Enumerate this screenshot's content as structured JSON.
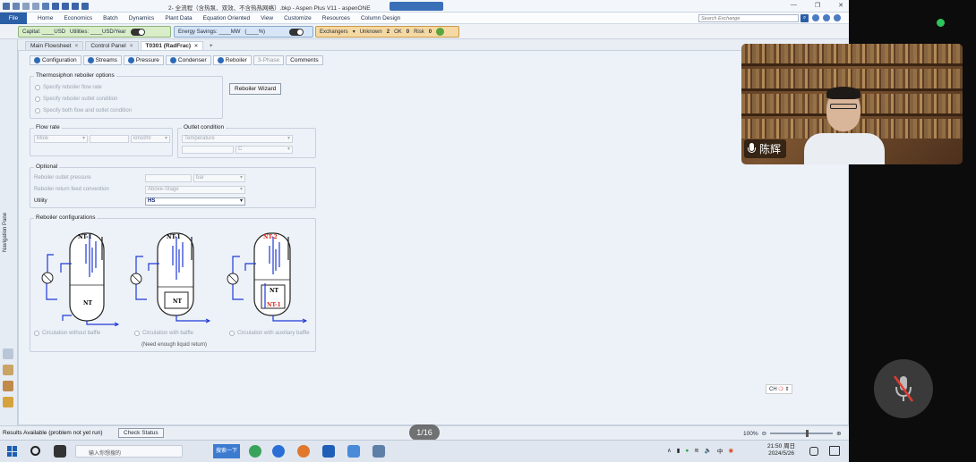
{
  "window": {
    "title": "2- 全流程（含热泵、双效、不含热热网络）.bkp - Aspen Plus V11 - aspenONE",
    "badge": "",
    "controls": [
      "—",
      "❐",
      "✕"
    ]
  },
  "menu": {
    "file": "File",
    "items": [
      "Home",
      "Economics",
      "Batch",
      "Dynamics",
      "Plant Data",
      "Equation Oriented",
      "View",
      "Customize",
      "Resources",
      "Column Design"
    ],
    "search_placeholder": "Search Exchange"
  },
  "econbar": {
    "capital": "Capital: ____USD",
    "utilities": "Utilities: ____USD/Year",
    "energy": "Energy Savings: ____MW",
    "energy_pct": "(____%)",
    "exchangers": "Exchangers",
    "unknown_label": "Unknown",
    "unknown_val": "2",
    "ok_label": "OK",
    "ok_val": "0",
    "risk_label": "Risk",
    "risk_val": "0"
  },
  "navpane": {
    "label": "Navigation Pane"
  },
  "doctabs": [
    {
      "label": "Main Flowsheet",
      "active": false
    },
    {
      "label": "Control Panel",
      "active": false
    },
    {
      "label": "T0301 (RadFrac)",
      "active": true
    }
  ],
  "doctab_add": "+",
  "formtabs": [
    {
      "label": "Configuration",
      "state": "done"
    },
    {
      "label": "Streams",
      "state": "done"
    },
    {
      "label": "Pressure",
      "state": "done"
    },
    {
      "label": "Condenser",
      "state": "done"
    },
    {
      "label": "Reboiler",
      "state": "active"
    },
    {
      "label": "3-Phase",
      "state": "disabled"
    },
    {
      "label": "Comments",
      "state": "plain"
    }
  ],
  "thermosiphon": {
    "title": "Thermosiphon reboiler options",
    "options": [
      "Specify reboiler flow rate",
      "Specify reboiler outlet condition",
      "Specify both flow and outlet condition"
    ]
  },
  "reboiler_wizard": "Reboiler Wizard",
  "flowrate": {
    "title": "Flow rate",
    "basis": "Mole",
    "unit": "kmol/hr"
  },
  "outlet": {
    "title": "Outlet condition",
    "type": "Temperature",
    "unit": "C"
  },
  "optional": {
    "title": "Optional",
    "pressure_label": "Reboiler outlet pressure",
    "pressure_unit": "bar",
    "return_label": "Reboiler return feed convention",
    "return_value": "Above-Stage",
    "utility_label": "Utility",
    "utility_value": "HS"
  },
  "configs": {
    "title": "Reboiler configurations",
    "options": [
      "Circulation without baffle",
      "Circulation with baffle",
      "Circulation with auxiliary baffle"
    ],
    "note": "(Need enough liquid return)",
    "diagram_labels": {
      "d1_top": "NT-1",
      "d1_bottom": "NT",
      "d2_top": "NT-1",
      "d2_bottom": "NT",
      "d3_top": "NT-2",
      "d3_bottom": "NT",
      "d3_inner": "NT-1"
    }
  },
  "status": {
    "text": "Results Available (problem not yet run)",
    "check": "Check Status",
    "zoom": "100%"
  },
  "page_indicator": "1/16",
  "ime": "CH",
  "taskbar": {
    "search": "输入你想搜的",
    "button": "搜索一下",
    "time": "21:50 周日",
    "date": "2024/5/26"
  },
  "video": {
    "speaker_name": "陈辉"
  },
  "colors": {
    "file_blue": "#2b5fa6",
    "capital_green": "#d9edc9",
    "energy_blue": "#d6e6f6",
    "exchanger_orange": "#f6d9a2",
    "diagram_blue": "#1f3ad6",
    "label_red": "#d8261b"
  }
}
